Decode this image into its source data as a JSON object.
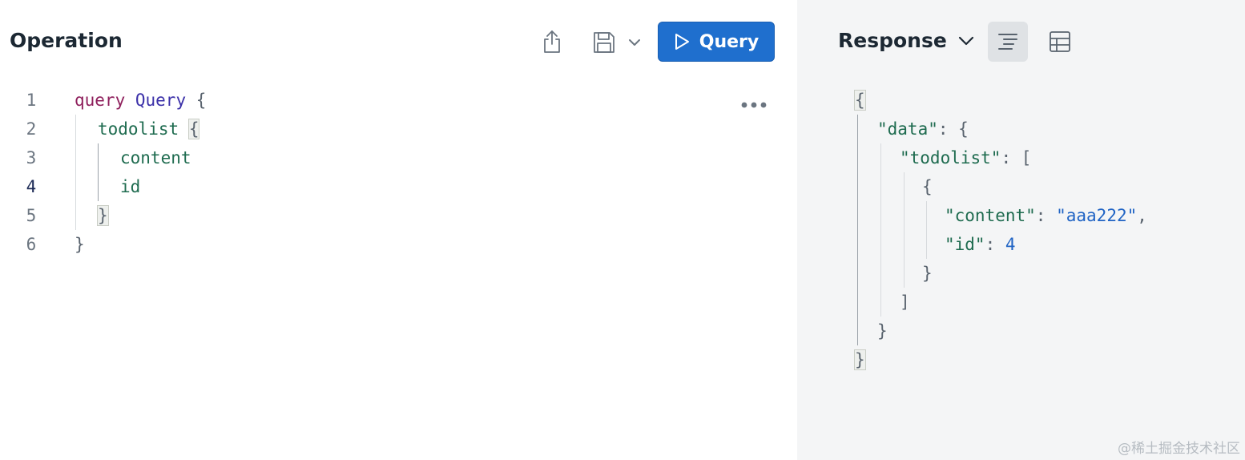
{
  "operation": {
    "title": "Operation",
    "run_button_label": "Query",
    "line_numbers": [
      "1",
      "2",
      "3",
      "4",
      "5",
      "6"
    ],
    "active_line": "4",
    "code": {
      "l1_keyword": "query",
      "l1_name": "Query",
      "l1_brace": "{",
      "l2_field": "todolist",
      "l2_brace": "{",
      "l3_field": "content",
      "l4_field": "id",
      "l5_brace": "}",
      "l6_brace": "}"
    }
  },
  "response": {
    "title": "Response",
    "json": {
      "open": "{",
      "data_key": "\"data\"",
      "colon": ":",
      "data_open": "{",
      "todolist_key": "\"todolist\"",
      "todolist_open": "[",
      "item_open": "{",
      "content_key": "\"content\"",
      "content_value": "\"aaa222\"",
      "comma": ",",
      "id_key": "\"id\"",
      "id_value": "4",
      "item_close": "}",
      "todolist_close": "]",
      "data_close": "}",
      "close": "}"
    }
  },
  "watermark": "@稀土掘金技术社区",
  "colors": {
    "accent": "#1f6fce",
    "keyword": "#8e1f5c",
    "type_name": "#3a2fa8",
    "field": "#1e6b4f",
    "string": "#1f63c4",
    "response_bg": "#f4f5f6"
  }
}
